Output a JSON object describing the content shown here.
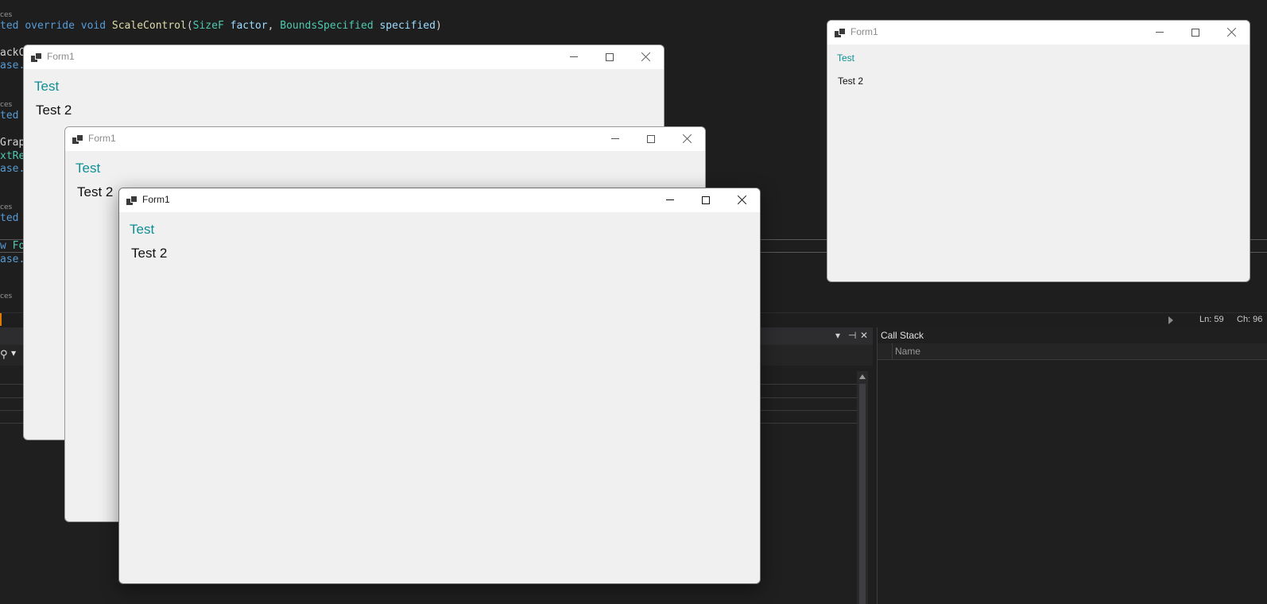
{
  "ide": {
    "code": {
      "codelens": [
        "ces",
        "ces",
        "ces",
        "ces"
      ],
      "scale_line": {
        "prefix": "ted",
        "kw1": "override",
        "kw2": "void",
        "method": "ScaleControl",
        "open": "(",
        "type1": "SizeF",
        "param1": "factor",
        "comma": ",",
        "type2": "BoundsSpecified",
        "param2": "specified",
        "close": ")"
      },
      "frag_ackc": "ackCo",
      "frag_ase_s": "ase.S",
      "frag_ted2": "ted",
      "frag_grap": "Grap",
      "frag_xtre": "xtRe",
      "frag_ase_c": "ase.C",
      "frag_ted3": "ted",
      "frag_w": "w",
      "frag_fo": "Fo",
      "frag_ase_c2": "ase.C"
    },
    "status": {
      "line": "Ln: 59",
      "char": "Ch: 96"
    },
    "pane_controls": {
      "dropdown": "▾",
      "pin": "⊣",
      "close": "✕"
    },
    "call_stack": {
      "title": "Call Stack",
      "col_name": "Name"
    }
  },
  "windows": [
    {
      "title": "Form1",
      "label1": "Test",
      "label2": "Test 2"
    },
    {
      "title": "Form1",
      "label1": "Test",
      "label2": "Test 2"
    },
    {
      "title": "Form1",
      "label1": "Test",
      "label2": "Test 2"
    },
    {
      "title": "Form1",
      "label1": "Test",
      "label2": "Test 2"
    }
  ]
}
